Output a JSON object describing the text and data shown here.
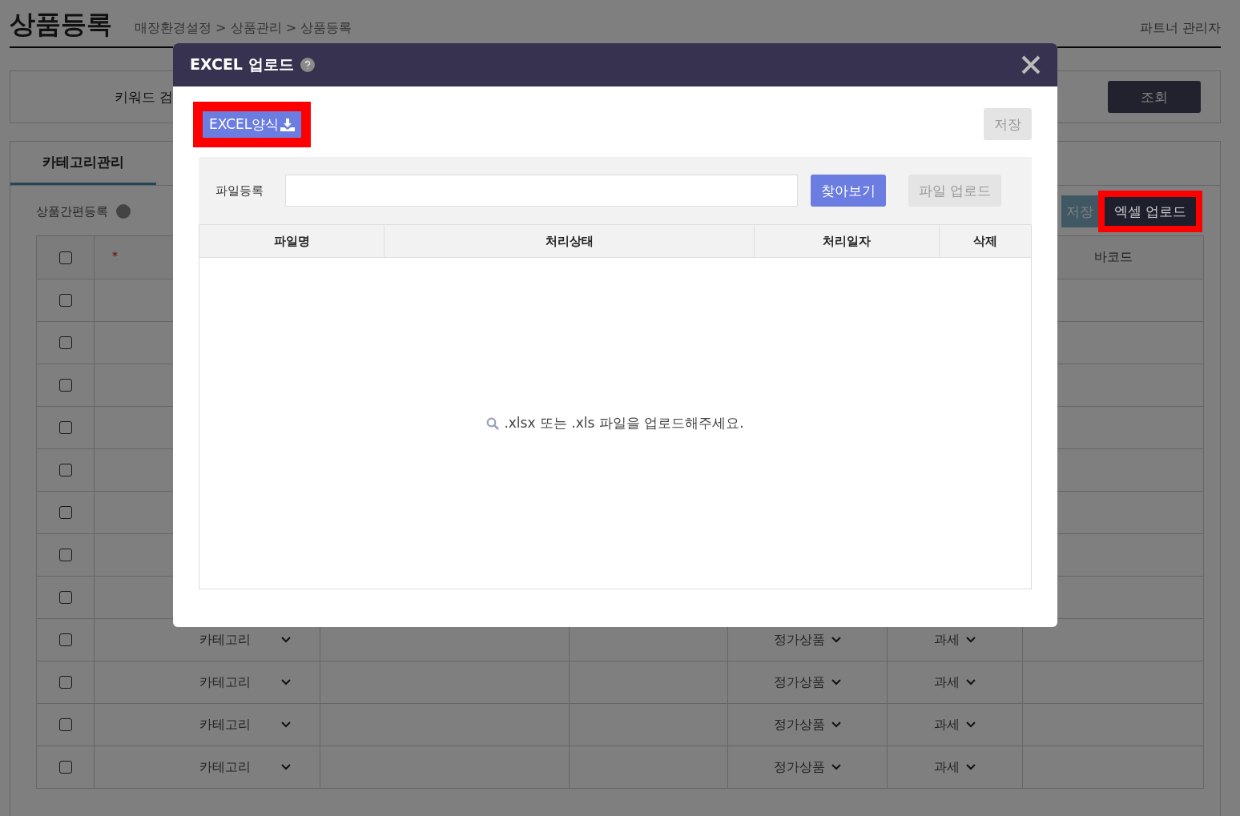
{
  "page": {
    "title": "상품등록",
    "breadcrumb": "매장환경설정 > 상품관리 > 상품등록",
    "user": "파트너 관리자"
  },
  "search": {
    "label": "키워드 검",
    "button": "조회"
  },
  "tabs": [
    {
      "label": "카테고리관리",
      "selected": true
    }
  ],
  "section": {
    "title": "상품간편등록",
    "save_button": "저장",
    "upload_button": {
      "label": "엑셀 업로드",
      "highlighted": true
    }
  },
  "table": {
    "columns": [
      {
        "kind": "checkbox",
        "checked": false
      },
      {
        "kind": "required",
        "label": "*"
      },
      {
        "kind": "blank"
      },
      {
        "kind": "blank"
      },
      {
        "kind": "blank"
      },
      {
        "kind": "blank"
      },
      {
        "kind": "text",
        "label": "바코드"
      }
    ],
    "rows": [
      {
        "checked": false
      },
      {
        "checked": false
      },
      {
        "checked": false
      },
      {
        "checked": false
      },
      {
        "checked": false
      },
      {
        "checked": false
      },
      {
        "checked": false
      },
      {
        "checked": false
      },
      {
        "checked": false,
        "category": "카테고리",
        "product_type": "정가상품",
        "tax": "과세"
      },
      {
        "checked": false,
        "category": "카테고리",
        "product_type": "정가상품",
        "tax": "과세"
      },
      {
        "checked": false,
        "category": "카테고리",
        "product_type": "정가상품",
        "tax": "과세"
      },
      {
        "checked": false,
        "category": "카테고리",
        "product_type": "정가상품",
        "tax": "과세"
      }
    ]
  },
  "dialog": {
    "title": "EXCEL 업로드",
    "template_button": {
      "label": "EXCEL양식",
      "highlighted": true
    },
    "save_button": {
      "label": "저장",
      "disabled": true
    },
    "file_label": "파일등록",
    "browse_button": {
      "label": "찾아보기",
      "disabled": false
    },
    "upload_button": {
      "label": "파일 업로드",
      "disabled": true
    },
    "columns": [
      "파일명",
      "처리상태",
      "처리일자",
      "삭제"
    ],
    "empty_message": ".xlsx 또는 .xls 파일을 업로드해주세요."
  }
}
